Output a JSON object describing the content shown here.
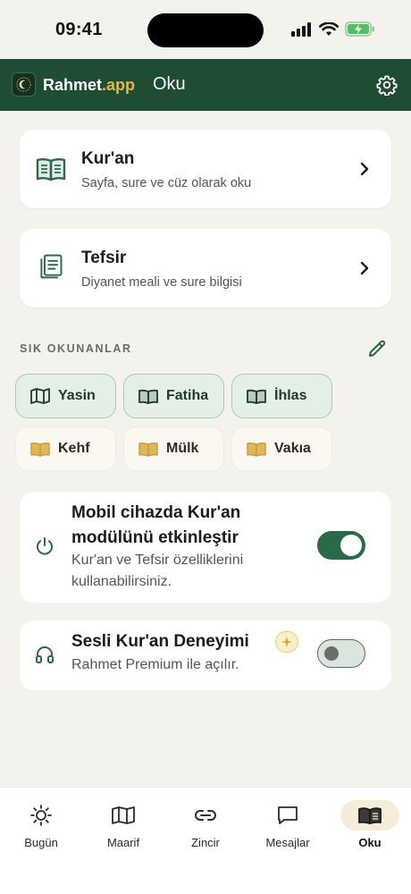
{
  "status_bar": {
    "time": "09:41"
  },
  "header": {
    "brand_main": "Rahmet",
    "brand_accent": ".app",
    "title": "Oku"
  },
  "cards": [
    {
      "title": "Kur'an",
      "subtitle": "Sayfa, sure ve cüz olarak oku"
    },
    {
      "title": "Tefsir",
      "subtitle": "Diyanet meali ve sure bilgisi"
    }
  ],
  "frequent": {
    "label": "SIK OKUNANLAR",
    "chips": [
      "Yasin",
      "Fatiha",
      "İhlas",
      "Kehf",
      "Mülk",
      "Vakıa"
    ]
  },
  "toggles": [
    {
      "title_line1": "Mobil cihazda Kur'an",
      "title_line2": "modülünü etkinleştir",
      "desc_line1": "Kur'an ve Tefsir özelliklerini",
      "desc_line2": "kullanabilirsiniz.",
      "enabled": true
    },
    {
      "title": "Sesli Kur'an Deneyimi",
      "desc": "Rahmet Premium ile açılır.",
      "enabled": false
    }
  ],
  "bottom_nav": {
    "tabs": [
      "Bugün",
      "Maarif",
      "Zincir",
      "Mesajlar",
      "Oku"
    ],
    "active": "Oku"
  },
  "colors": {
    "header_bg": "#1f4d34",
    "accent_gold": "#e2b84d",
    "switch_on": "#2b6948",
    "page_bg": "#f4f2ec"
  },
  "icons": [
    "signal-icon",
    "wifi-icon",
    "battery-charging-icon",
    "crescent-logo-icon",
    "gear-icon",
    "book-open-icon",
    "document-lines-icon",
    "chevron-right-icon",
    "pencil-icon",
    "power-icon",
    "headphones-icon",
    "sparkle-icon",
    "sun-icon",
    "book-map-icon",
    "link-icon",
    "chat-bubble-icon"
  ]
}
